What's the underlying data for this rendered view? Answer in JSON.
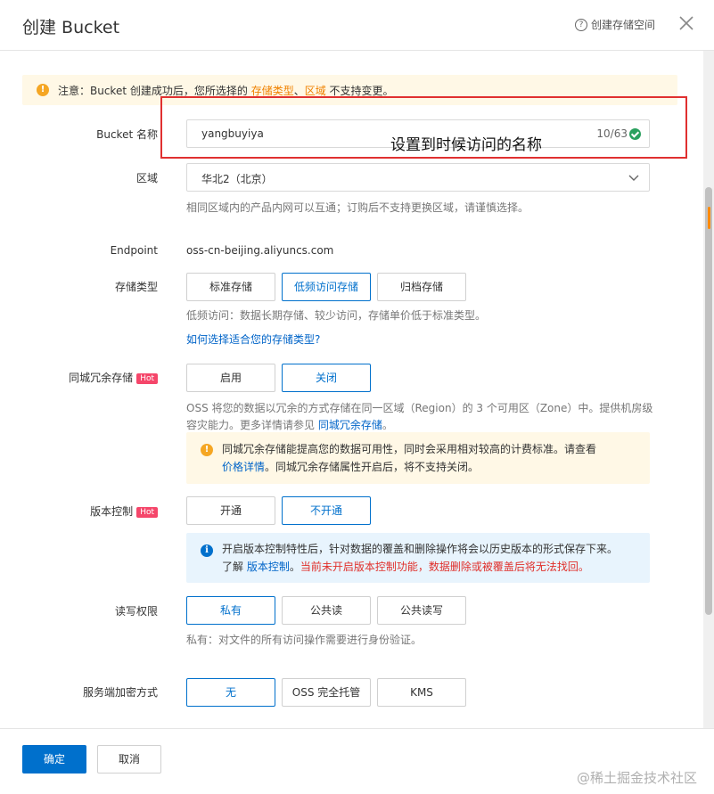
{
  "header": {
    "title": "创建 Bucket",
    "help_label": "创建存储空间",
    "help_icon": "question-circle-icon",
    "close_icon": "close-icon"
  },
  "notice": {
    "prefix": "注意：Bucket 创建成功后，您所选择的 ",
    "link1": "存储类型",
    "sep": "、",
    "link2": "区域",
    "suffix": " 不支持变更。"
  },
  "bucket_name": {
    "label": "Bucket 名称",
    "value": "yangbuyiya",
    "counter": "10/63"
  },
  "annotation": "设置到时候访问的名称",
  "region": {
    "label": "区域",
    "value": "华北2（北京）",
    "hint": "相同区域内的产品内网可以互通；订购后不支持更换区域，请谨慎选择。"
  },
  "endpoint": {
    "label": "Endpoint",
    "value": "oss-cn-beijing.aliyuncs.com"
  },
  "storage_class": {
    "label": "存储类型",
    "options": [
      "标准存储",
      "低频访问存储",
      "归档存储"
    ],
    "selected": "低频访问存储",
    "hint": "低频访问：数据长期存储、较少访问，存储单价低于标准类型。",
    "link": "如何选择适合您的存储类型?"
  },
  "redundancy": {
    "label": "同城冗余存储",
    "badge": "Hot",
    "options": [
      "启用",
      "关闭"
    ],
    "selected": "关闭",
    "hint_line1": "OSS 将您的数据以冗余的方式存储在同一区域（Region）的 3 个可用区（Zone）中。提供机房级",
    "hint_line2_prefix": "容灾能力。更多详情请参见 ",
    "hint_link": "同城冗余存储",
    "hint_line2_suffix": "。",
    "tip_line1": "同城冗余存储能提高您的数据可用性，同时会采用相对较高的计费标准。请查看",
    "tip_link": "价格详情",
    "tip_line2_suffix": "。同城冗余存储属性开启后，将不支持关闭。"
  },
  "versioning": {
    "label": "版本控制",
    "badge": "Hot",
    "options": [
      "开通",
      "不开通"
    ],
    "selected": "不开通",
    "tip_line1": "开启版本控制特性后，针对数据的覆盖和删除操作将会以历史版本的形式保存下来。",
    "tip_line2_prefix": "了解 ",
    "tip_link": "版本控制",
    "tip_line2_mid": "。",
    "tip_warning": "当前未开启版本控制功能，数据删除或被覆盖后将无法找回。"
  },
  "acl": {
    "label": "读写权限",
    "options": [
      "私有",
      "公共读",
      "公共读写"
    ],
    "selected": "私有",
    "hint": "私有：对文件的所有访问操作需要进行身份验证。"
  },
  "encryption": {
    "label": "服务端加密方式",
    "options": [
      "无",
      "OSS 完全托管",
      "KMS"
    ],
    "selected": "无"
  },
  "footer": {
    "ok": "确定",
    "cancel": "取消",
    "watermark": "@稀土掘金技术社区"
  },
  "colors": {
    "primary": "#0070cc",
    "warning": "#f5a623",
    "hot": "#f5466a",
    "annotation_border": "#e03030"
  }
}
